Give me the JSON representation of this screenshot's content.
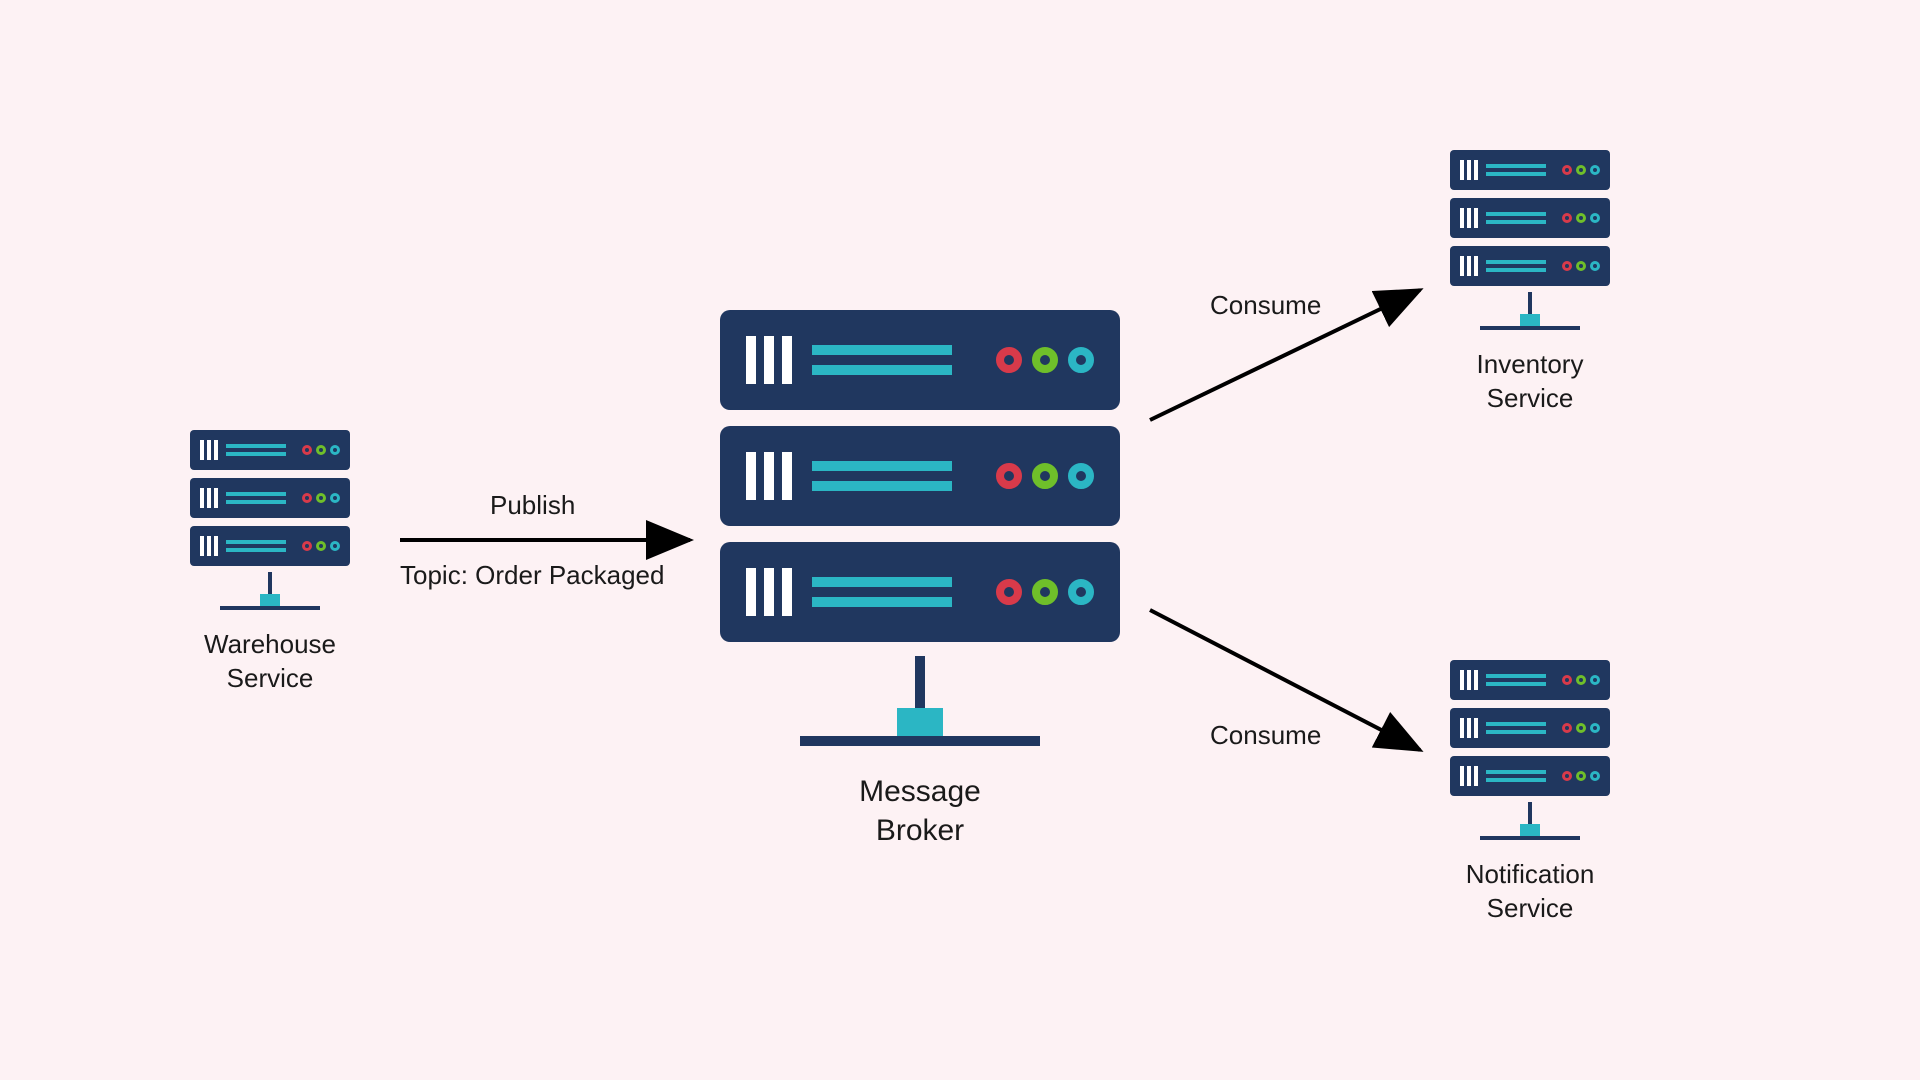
{
  "nodes": {
    "warehouse": {
      "label_l1": "Warehouse",
      "label_l2": "Service"
    },
    "broker": {
      "label_l1": "Message",
      "label_l2": "Broker"
    },
    "inventory": {
      "label_l1": "Inventory",
      "label_l2": "Service"
    },
    "notification": {
      "label_l1": "Notification",
      "label_l2": "Service"
    }
  },
  "edges": {
    "publish": {
      "label": "Publish",
      "topic": "Topic: Order Packaged"
    },
    "consume1": {
      "label": "Consume"
    },
    "consume2": {
      "label": "Consume"
    }
  },
  "colors": {
    "bg": "#fdf2f4",
    "server_body": "#20375f",
    "accent": "#2bb6c4",
    "red": "#d83a4a",
    "green": "#6fbf2a"
  }
}
